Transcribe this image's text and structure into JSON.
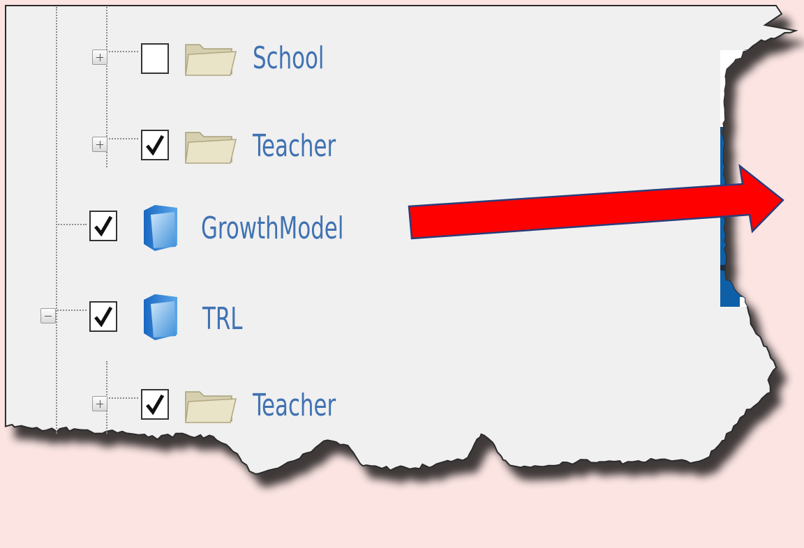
{
  "tree": {
    "nodes": [
      {
        "id": "school",
        "label": "School",
        "type": "folder",
        "expander": "plus",
        "checked": false
      },
      {
        "id": "teacher-1",
        "label": "Teacher",
        "type": "folder",
        "expander": "plus",
        "checked": true
      },
      {
        "id": "growthmodel",
        "label": "GrowthModel",
        "type": "cube",
        "expander": "none",
        "checked": true
      },
      {
        "id": "trl",
        "label": "TRL",
        "type": "cube",
        "expander": "minus",
        "checked": true
      },
      {
        "id": "teacher-2",
        "label": "Teacher",
        "type": "folder",
        "expander": "plus",
        "checked": true
      }
    ]
  },
  "icons": {
    "folder": "folder-icon",
    "cube": "cube-icon",
    "checkmark": "checkmark-icon"
  },
  "colors": {
    "background": "#fbe4e2",
    "panel": "#f0f0f0",
    "label": "#3f72b2",
    "arrow": "#ff0000",
    "button_blue": "#0d5fa8"
  }
}
